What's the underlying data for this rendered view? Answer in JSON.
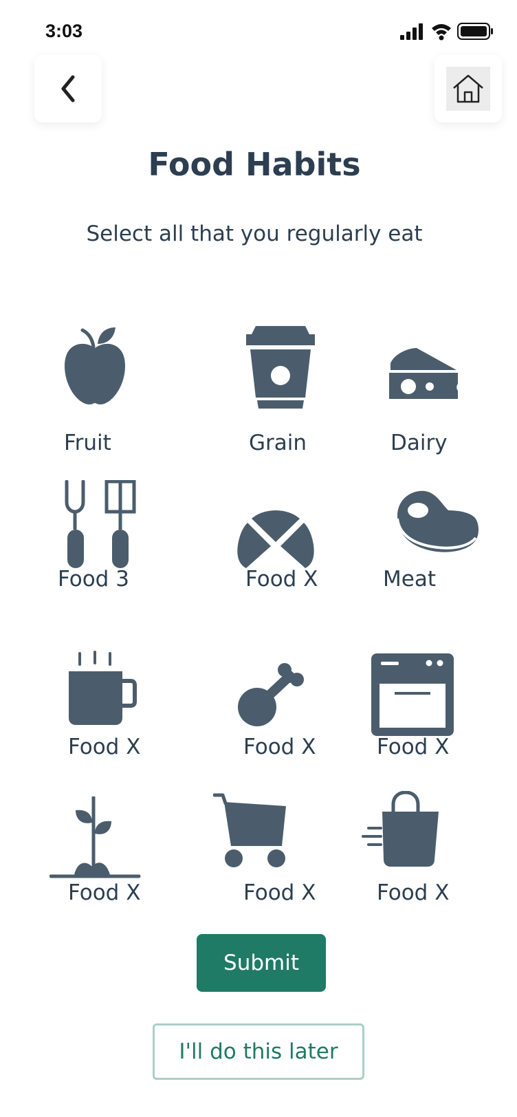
{
  "status_bar": {
    "time": "3:03",
    "icons": [
      "cellular-signal-icon",
      "wifi-icon",
      "battery-icon"
    ]
  },
  "header": {
    "back_icon": "chevron-left-icon",
    "home_icon": "home-icon"
  },
  "page": {
    "title": "Food Habits",
    "subtitle": "Select all that you regularly eat"
  },
  "food_options": [
    {
      "label": "Fruit",
      "icon": "apple-icon"
    },
    {
      "label": "Grain",
      "icon": "coffee-cup-icon"
    },
    {
      "label": "Dairy",
      "icon": "cheese-icon"
    },
    {
      "label": "Food 3",
      "icon": "bbq-tools-icon"
    },
    {
      "label": "Food X",
      "icon": "croissant-icon"
    },
    {
      "label": "Meat",
      "icon": "steak-icon"
    },
    {
      "label": "Food X",
      "icon": "hot-mug-icon"
    },
    {
      "label": "Food X",
      "icon": "chicken-leg-icon"
    },
    {
      "label": "Food X",
      "icon": "oven-icon"
    },
    {
      "label": "Food X",
      "icon": "sprout-icon"
    },
    {
      "label": "Food X",
      "icon": "shopping-cart-icon"
    },
    {
      "label": "Food X",
      "icon": "fast-delivery-bag-icon"
    }
  ],
  "actions": {
    "submit_label": "Submit",
    "later_label": "I'll do this later"
  },
  "colors": {
    "icon": "#4b5d6c",
    "text": "#2c3e50",
    "primary": "#1f7a66",
    "secondary_border": "#a9cfc8"
  }
}
